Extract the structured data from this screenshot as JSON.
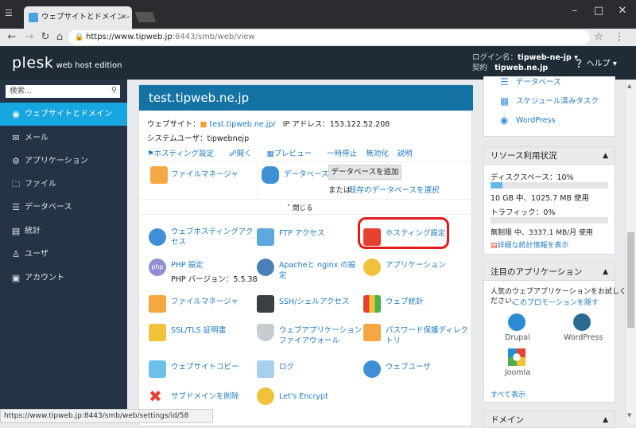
{
  "browser": {
    "tab_title": "ウェブサイトとドメイン - Plesk",
    "url_host": "https://www.tipweb.jp",
    "url_rest": ":8443/smb/web/view",
    "status_url": "https://www.tipweb.jp:8443/smb/web/settings/id/58"
  },
  "topbar": {
    "logo": "plesk",
    "edition": "web host edition",
    "login_label": "ログイン名：",
    "login_name": "tipweb-ne-jp ▾",
    "contract_label": "契約",
    "contract_name": "tipweb.ne.jp",
    "help": "ヘルプ ▾"
  },
  "sidebar": {
    "search_placeholder": "検索...",
    "items": [
      {
        "label": "ウェブサイトとドメイン"
      },
      {
        "label": "メール"
      },
      {
        "label": "アプリケーション"
      },
      {
        "label": "ファイル"
      },
      {
        "label": "データベース"
      },
      {
        "label": "統計"
      },
      {
        "label": "ユーザ"
      },
      {
        "label": "アカウント"
      }
    ]
  },
  "domain": {
    "name": "test.tipweb.ne.jp",
    "website_label": "ウェブサイト：",
    "website_link": "test.tipweb.ne.jp/",
    "ip_label": "IP アドレス：153.122.52.208",
    "sysuser": "システムユーザ：tipwebnejp",
    "actions": [
      "ホスティング設定",
      "開く",
      "プレビュー",
      "一時停止",
      "無効化",
      "説明"
    ],
    "file_manager": "ファイルマネージャ",
    "database": "データベース",
    "add_db": "データベースを追加",
    "or": "または",
    "select_db": "既存のデータベースを選択",
    "collapse": "閉じる",
    "tiles": [
      {
        "label": "ウェブホスティングアク\nセス"
      },
      {
        "label": "FTP アクセス"
      },
      {
        "label": "ホスティング設定"
      },
      {
        "label": "PHP 設定"
      },
      {
        "label": "Apacheと nginx の設\n定"
      },
      {
        "label": "アプリケーション"
      },
      {
        "label": "ファイルマネージャ"
      },
      {
        "label": "SSH/シェルアクセス"
      },
      {
        "label": "ウェブ統計"
      },
      {
        "label": "SSL/TLS 証明書"
      },
      {
        "label": "ウェブアプリケーション\nファイアウォール"
      },
      {
        "label": "パスワード保護ディレク\nトリ"
      },
      {
        "label": "ウェブサイトコピー"
      },
      {
        "label": "ログ"
      },
      {
        "label": "ウェブユーザ"
      },
      {
        "label": "サブドメインを削除"
      },
      {
        "label": "Let's Encrypt"
      }
    ],
    "php_version": "PHP バージョン：5.5.38"
  },
  "right": {
    "links": [
      "データベース",
      "スケジュール済みタスク",
      "WordPress"
    ],
    "usage": {
      "title": "リソース利用状況",
      "disk_label": "ディスクスペース：10%",
      "disk_pct": 10,
      "disk_detail": "10 GB 中、1025.7 MB 使用",
      "traffic_label": "トラフィック：0%",
      "traffic_pct": 0,
      "traffic_detail": "無制限 中、3337.1 MB/月 使用",
      "stats_link": "詳細な統計情報を表示"
    },
    "apps": {
      "title": "注目のアプリケーション",
      "desc": "人気のウェブアプリケーションをお試しく\nださい。",
      "hide_link": "このプロモーションを隠す",
      "items": [
        "Drupal",
        "WordPress",
        "Joomla"
      ],
      "show_all": "すべて表示"
    },
    "domains_head": "ドメイン"
  },
  "colors": {
    "accent": "#16a6e0",
    "header": "#1472a4",
    "sidebar": "#253444",
    "highlight": "#e41b1b"
  }
}
